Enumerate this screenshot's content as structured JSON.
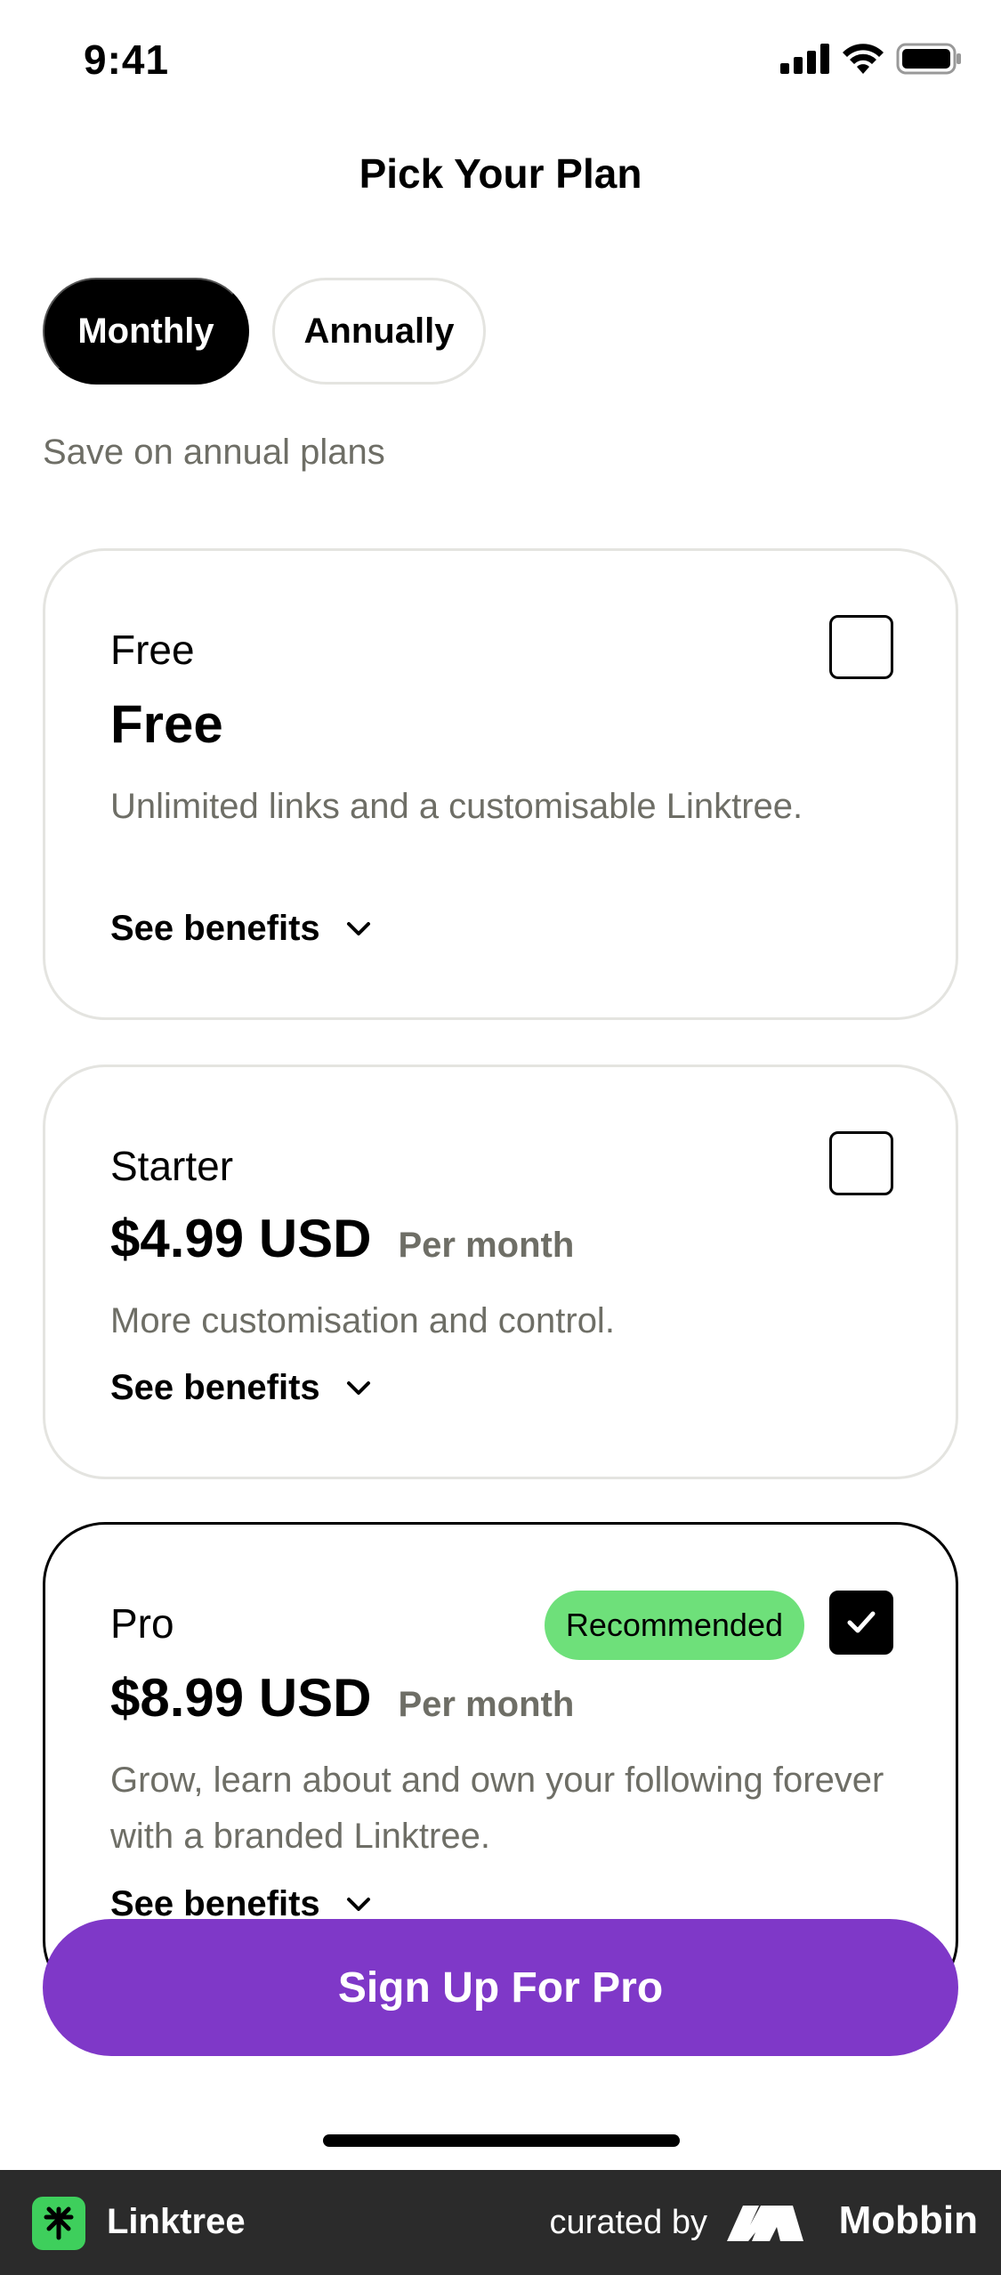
{
  "status_bar": {
    "time": "9:41"
  },
  "header": {
    "title": "Pick Your Plan"
  },
  "billing_toggle": {
    "monthly": "Monthly",
    "annually": "Annually",
    "selected": "Monthly"
  },
  "save_note": "Save on annual plans",
  "plans": [
    {
      "name": "Free",
      "price": "Free",
      "period": "",
      "description": "Unlimited links and a customisable Linktree.",
      "benefits_label": "See benefits",
      "checked": false
    },
    {
      "name": "Starter",
      "price": "$4.99 USD",
      "period": "Per month",
      "description": "More customisation and control.",
      "benefits_label": "See benefits",
      "checked": false
    },
    {
      "name": "Pro",
      "price": "$8.99 USD",
      "period": "Per month",
      "badge": "Recommended",
      "description": "Grow, learn about and own your following forever with a branded Linktree.",
      "benefits_label": "See benefits",
      "checked": true
    }
  ],
  "cta": {
    "label": "Sign Up For Pro"
  },
  "footer": {
    "app_name": "Linktree",
    "curated_by": "curated by",
    "brand": "Mobbin"
  },
  "colors": {
    "accent": "#7f38c8",
    "badge": "#6ee07a",
    "muted_text": "#6e6e66",
    "border": "#e4e4e0"
  }
}
